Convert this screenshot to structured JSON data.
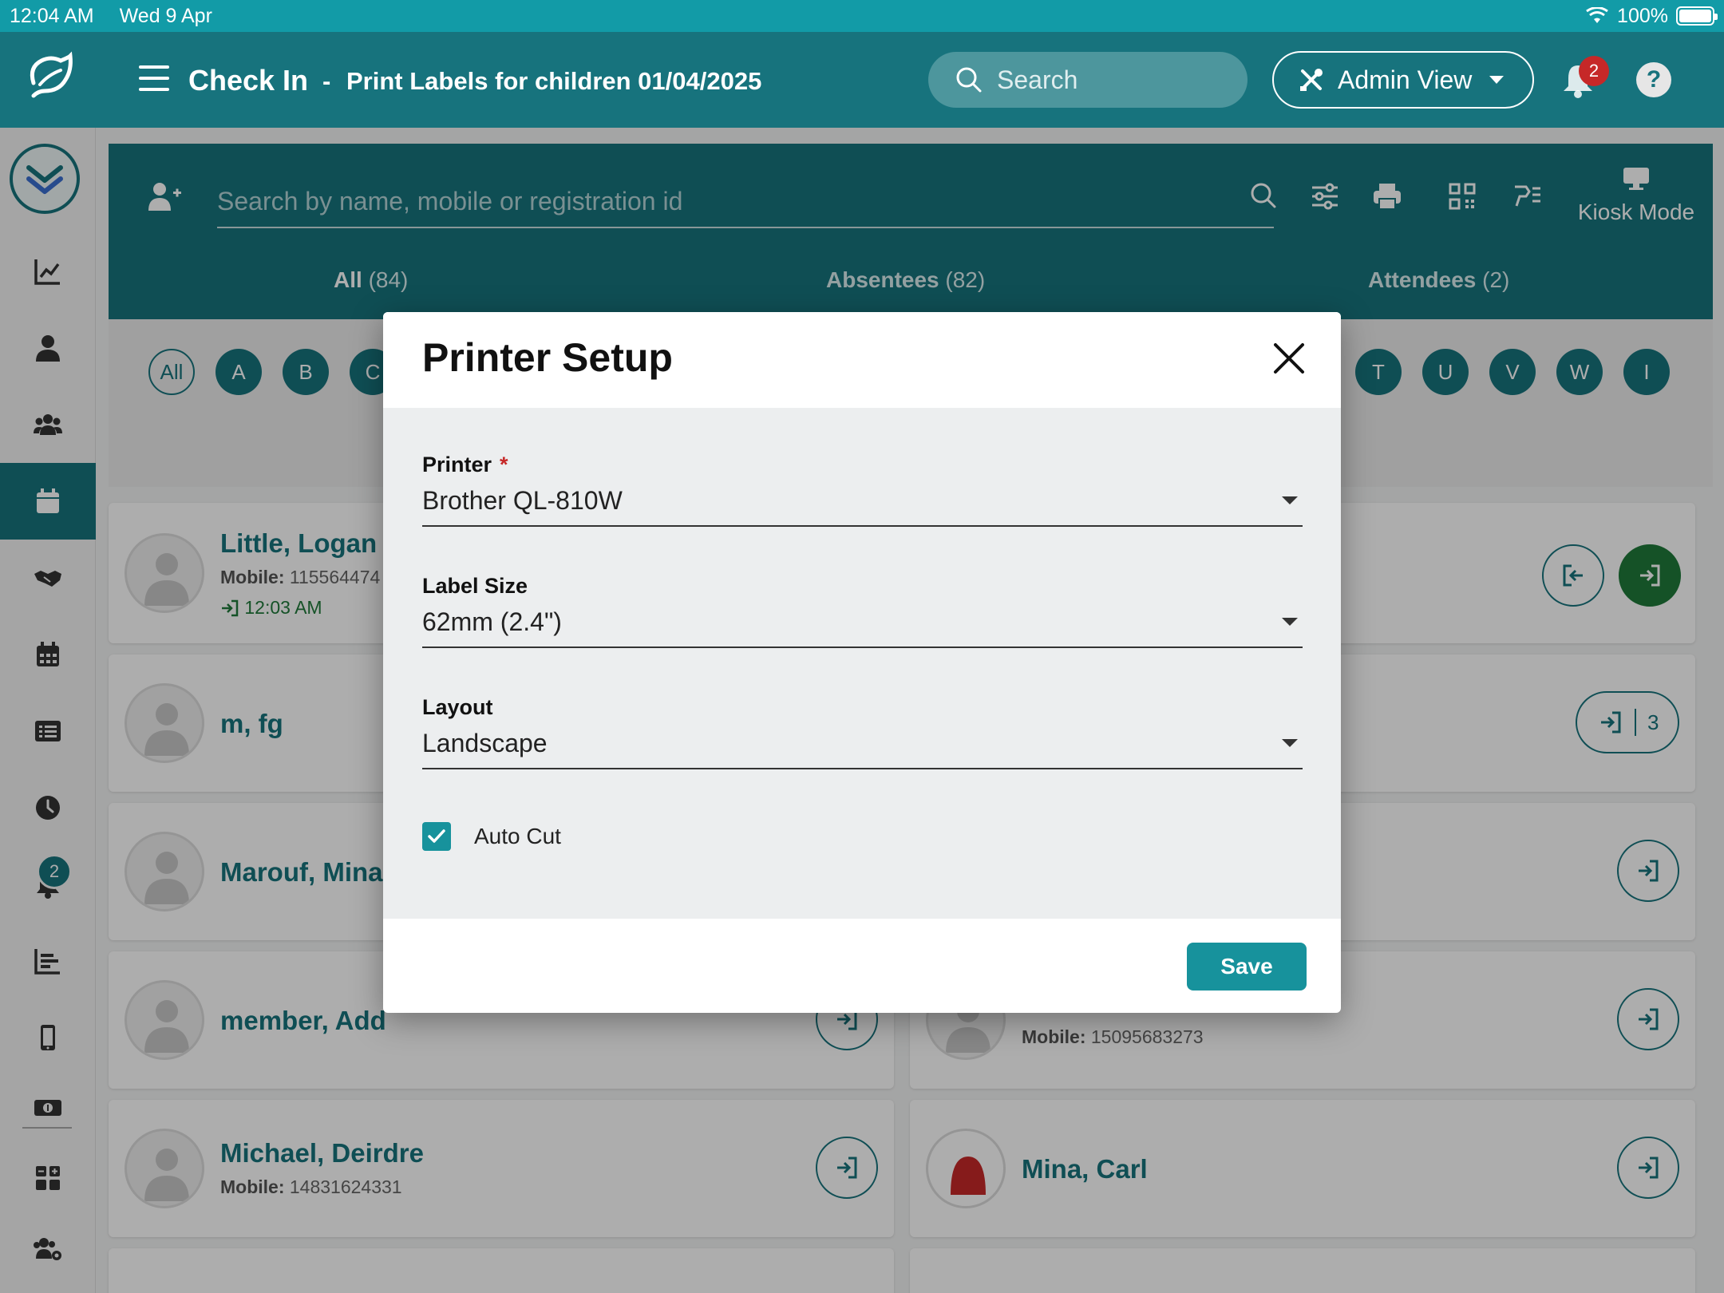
{
  "status_bar": {
    "time": "12:04 AM",
    "date": "Wed 9 Apr",
    "battery": "100%"
  },
  "app_bar": {
    "title": "Check In",
    "separator": "-",
    "subtitle": "Print Labels for children 01/04/2025",
    "search_placeholder": "Search",
    "admin_button": "Admin View",
    "notification_count": "2",
    "help_label": "?"
  },
  "sidebar": {
    "active_item": "calendar-day",
    "alerts_badge": "2"
  },
  "checkin": {
    "search_placeholder": "Search by name, mobile or registration id",
    "kiosk_label": "Kiosk Mode",
    "tabs": [
      {
        "label": "All",
        "count": "(84)"
      },
      {
        "label": "Absentees",
        "count": "(82)"
      },
      {
        "label": "Attendees",
        "count": "(2)"
      }
    ],
    "letters_left": [
      "All",
      "A",
      "B",
      "C"
    ],
    "letters_right": [
      "T",
      "U",
      "V",
      "W",
      "I"
    ]
  },
  "people": [
    {
      "name": "Little, Logan",
      "mobile_label": "Mobile:",
      "mobile": "115564474",
      "time": "12:03 AM"
    },
    {
      "name": "m, fg",
      "badge_count": "3"
    },
    {
      "name": "Marouf, Mina"
    },
    {
      "name": "member, Add"
    },
    {
      "name": "Michael, Deirdre",
      "mobile_label": "Mobile:",
      "mobile": "14831624331"
    },
    {
      "mobile_label": "Mobile:",
      "mobile": "15095683273"
    },
    {
      "name": "Mina, Carl"
    }
  ],
  "modal": {
    "title": "Printer Setup",
    "printer_label": "Printer",
    "required_mark": "*",
    "printer_value": "Brother QL-810W",
    "label_size_label": "Label Size",
    "label_size_value": "62mm (2.4\")",
    "layout_label": "Layout",
    "layout_value": "Landscape",
    "auto_cut_label": "Auto Cut",
    "auto_cut_checked": true,
    "save_label": "Save"
  },
  "colors": {
    "primary": "#17737d",
    "accent": "#17929c",
    "status_bar": "#129ba7",
    "checked_in": "#1f7a3a",
    "badge": "#c62828"
  }
}
